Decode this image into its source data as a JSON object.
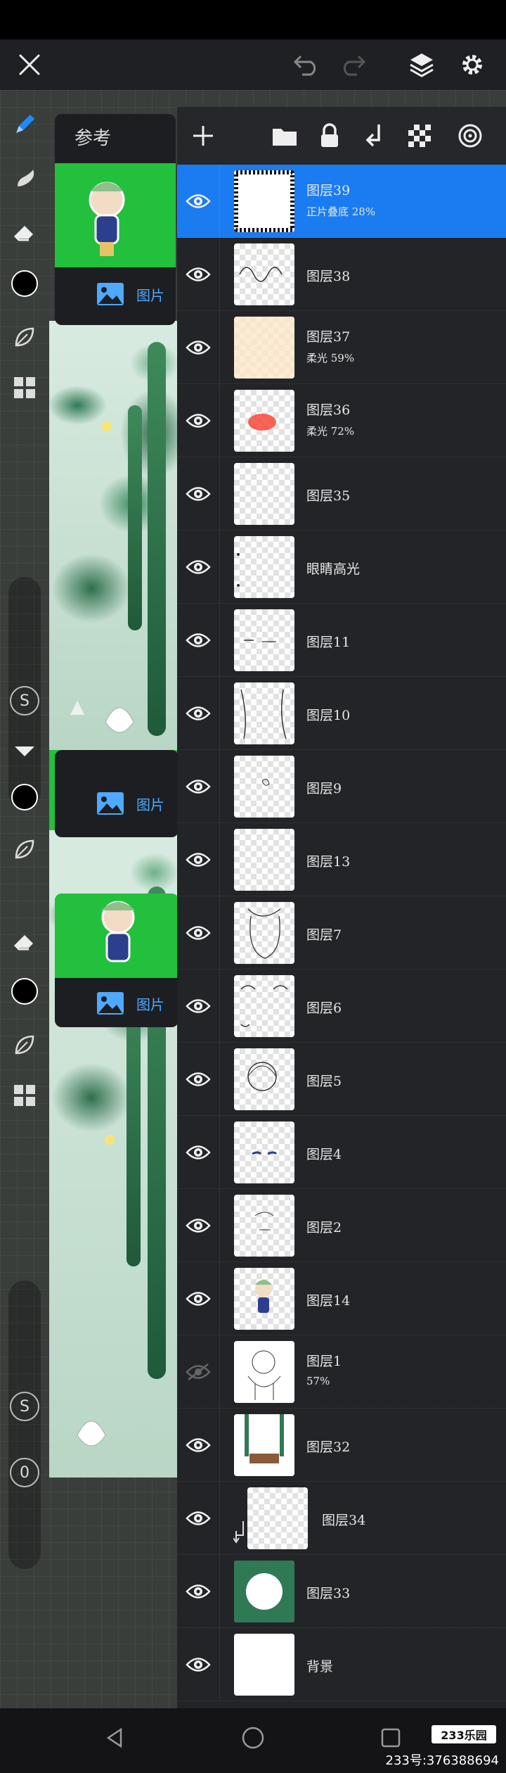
{
  "reference": {
    "title": "参考",
    "image_label": "图片"
  },
  "layers": [
    {
      "name": "图层39",
      "mode": "正片叠底  28%",
      "active": true
    },
    {
      "name": "图层38",
      "mode": ""
    },
    {
      "name": "图层37",
      "mode": "柔光  59%"
    },
    {
      "name": "图层36",
      "mode": "柔光  72%"
    },
    {
      "name": "图层35",
      "mode": ""
    },
    {
      "name": "眼睛高光",
      "mode": ""
    },
    {
      "name": "图层11",
      "mode": ""
    },
    {
      "name": "图层10",
      "mode": ""
    },
    {
      "name": "图层9",
      "mode": ""
    },
    {
      "name": "图层13",
      "mode": ""
    },
    {
      "name": "图层7",
      "mode": ""
    },
    {
      "name": "图层6",
      "mode": ""
    },
    {
      "name": "图层5",
      "mode": ""
    },
    {
      "name": "图层4",
      "mode": ""
    },
    {
      "name": "图层2",
      "mode": ""
    },
    {
      "name": "图层14",
      "mode": ""
    },
    {
      "name": "图层1",
      "mode": "57%",
      "hidden": true
    },
    {
      "name": "图层32",
      "mode": ""
    },
    {
      "name": "图层34",
      "mode": "",
      "clipped": true
    },
    {
      "name": "图层33",
      "mode": ""
    },
    {
      "name": "背景",
      "mode": ""
    }
  ],
  "tool_labels": {
    "size_button": "S",
    "opacity_button": "0"
  },
  "watermark": {
    "logo": "233乐园",
    "text": "233号:376388694"
  },
  "colors": {
    "active_layer": "#1a7cf0",
    "reference_link": "#4fa9ff",
    "reference_bg": "#22c03c"
  }
}
